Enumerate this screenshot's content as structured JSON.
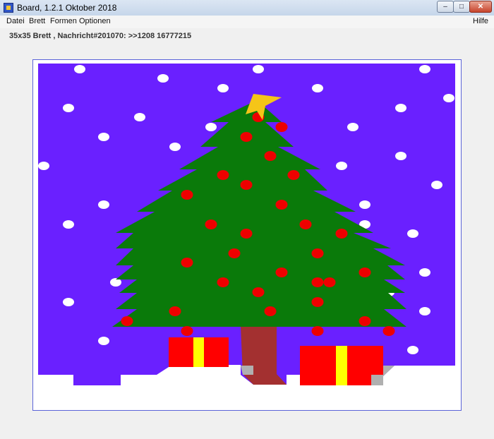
{
  "window": {
    "title": "Board, 1.2.1 Oktober 2018",
    "controls": {
      "minimize": "–",
      "maximize": "□",
      "close": "✕"
    }
  },
  "menu": {
    "file": "Datei",
    "board": "Brett",
    "shapes": "Formen",
    "options": "Optionen",
    "help": "Hilfe"
  },
  "status": {
    "text": "35x35 Brett , Nachricht#201070: >>1208 16777215"
  },
  "board": {
    "grid_size": 35,
    "colors": {
      "sky": "#6a20ff",
      "snow": "#ffffff",
      "tree": "#0a7a0a",
      "trunk": "#a33030",
      "ornament": "#ee0000",
      "star": "#f5c518",
      "gift": "#ff0000",
      "ribbon": "#ffff00",
      "shadow": "#b0b0b0"
    }
  }
}
